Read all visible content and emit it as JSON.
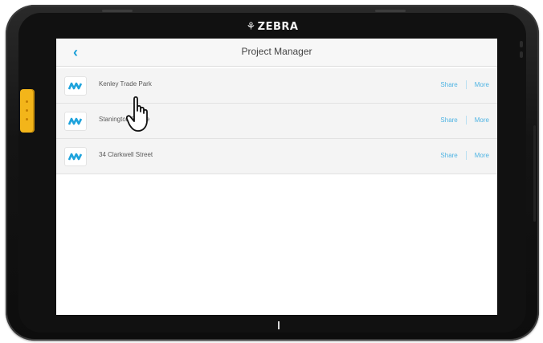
{
  "device": {
    "brand": "ZEBRA",
    "brand_logo_icon": "zebra-head-icon",
    "accent_button_color": "#f3b51a"
  },
  "app": {
    "title": "Project Manager",
    "back_icon": "chevron-left-icon",
    "accent_color": "#1b9fd8"
  },
  "projects": [
    {
      "name": "Kenley Trade Park",
      "share_label": "Share",
      "more_label": "More"
    },
    {
      "name": "Stanington Estate",
      "share_label": "Share",
      "more_label": "More"
    },
    {
      "name": "34 Clarkwell Street",
      "share_label": "Share",
      "more_label": "More"
    }
  ],
  "overlay": {
    "cursor_icon": "pointing-hand-icon"
  }
}
